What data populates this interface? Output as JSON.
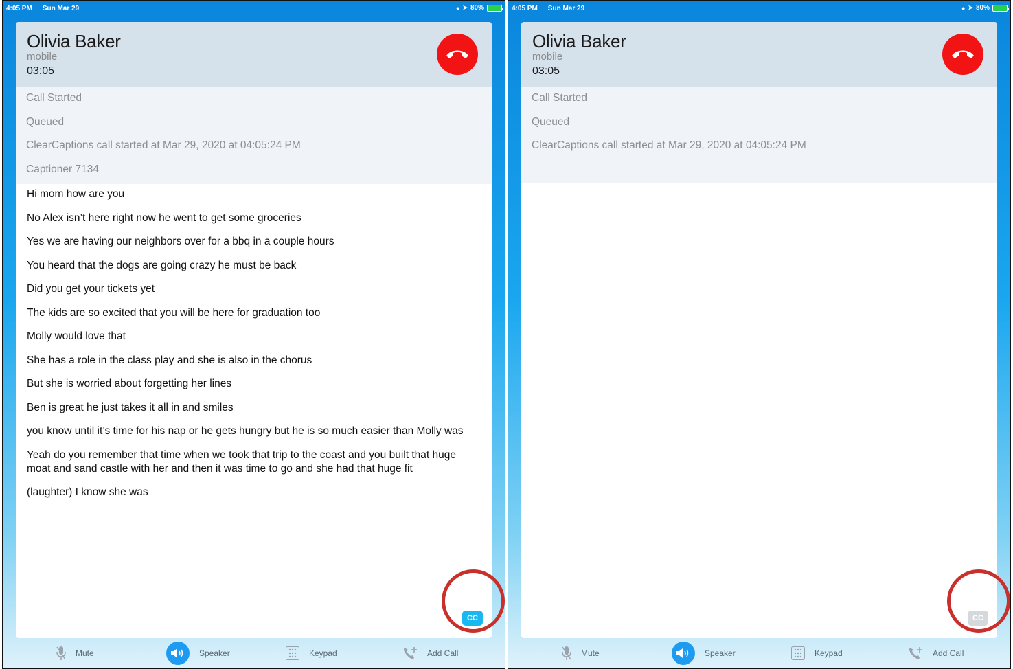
{
  "status_bar": {
    "time": "4:05 PM",
    "date": "Sun Mar 29",
    "battery": "80%"
  },
  "call": {
    "name": "Olivia Baker",
    "type": "mobile",
    "timer": "03:05"
  },
  "left_panel": {
    "system_lines": [
      "Call Started",
      "Queued",
      "ClearCaptions call started at Mar 29, 2020 at 04:05:24 PM",
      "Captioner 7134"
    ],
    "transcript": [
      "Hi mom how are you",
      "No Alex isn’t here right now he went to get some groceries",
      "Yes we are having our neighbors over for a bbq in a couple hours",
      "You heard that the dogs are going crazy he must be back",
      "Did you get your tickets yet",
      "The kids are so excited that you will be here for graduation too",
      "Molly would love that",
      "She has a role in the class play and she is also in the chorus",
      "But she is worried about forgetting her lines",
      "Ben is great he just takes it all in and smiles",
      "you know until it’s time for his nap or he gets hungry but he is so much easier than Molly was",
      "Yeah do you remember that time when we took that trip to the coast and you built that huge moat and sand castle with her and then it was time to go and she had that huge fit",
      "(laughter) I know she was"
    ],
    "cc_label": "CC",
    "cc_state": "on",
    "cc_color": "#1ab8f0"
  },
  "right_panel": {
    "system_lines": [
      "Call Started",
      "Queued",
      "ClearCaptions call started at Mar 29, 2020 at 04:05:24 PM"
    ],
    "cc_label": "CC",
    "cc_state": "off",
    "cc_color": "#d6d9dc"
  },
  "toolbar": {
    "mute_label": "Mute",
    "speaker_label": "Speaker",
    "keypad_label": "Keypad",
    "add_call_label": "Add Call",
    "icons": [
      "microphone-icon",
      "speaker-icon",
      "keypad-icon",
      "add-call-icon"
    ]
  },
  "colors": {
    "hangup": "#f21414",
    "speaker_active": "#1e9bf0",
    "highlight_ring": "#c9302c",
    "header_bg": "#d5e1eb"
  }
}
